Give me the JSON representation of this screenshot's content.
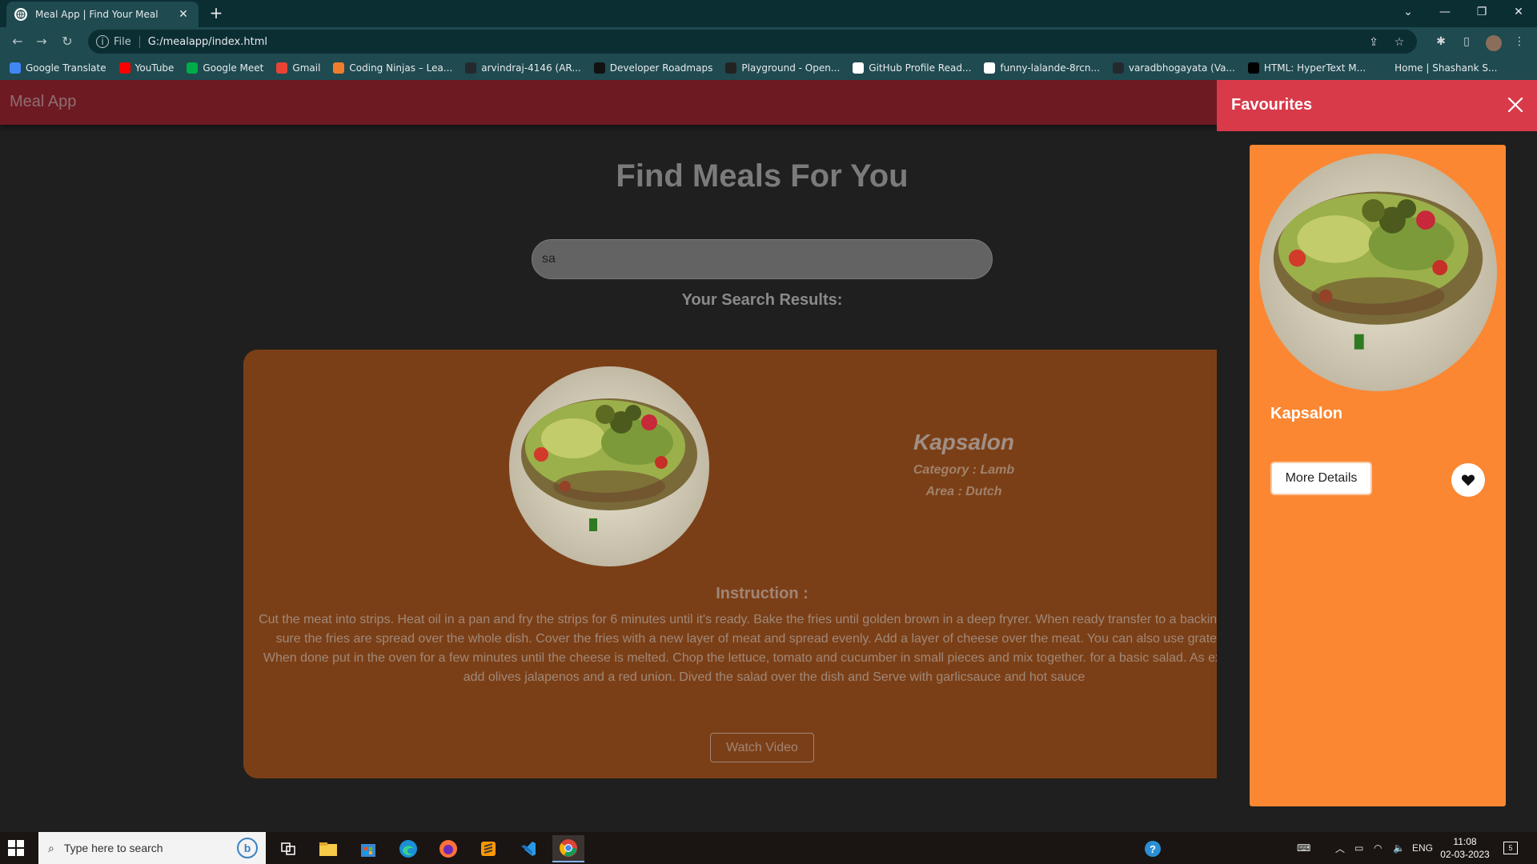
{
  "browser": {
    "tab_title": "Meal App | Find Your Meal",
    "url_scheme": "File",
    "url": "G:/mealapp/index.html",
    "bookmarks": [
      {
        "label": "Google Translate",
        "color": "#4285f4"
      },
      {
        "label": "YouTube",
        "color": "#ff0000"
      },
      {
        "label": "Google Meet",
        "color": "#00ac47"
      },
      {
        "label": "Gmail",
        "color": "#ea4335"
      },
      {
        "label": "Coding Ninjas – Lea...",
        "color": "#f07d2c"
      },
      {
        "label": "arvindraj-4146 (AR...",
        "color": "#24292e"
      },
      {
        "label": "Developer Roadmaps",
        "color": "#111111"
      },
      {
        "label": "Playground - Open...",
        "color": "#222222"
      },
      {
        "label": "GitHub Profile Read...",
        "color": "#ffffff"
      },
      {
        "label": "funny-lalande-8rcn...",
        "color": "#ffffff"
      },
      {
        "label": "varadbhogayata (Va...",
        "color": "#24292e"
      },
      {
        "label": "HTML: HyperText M...",
        "color": "#000000"
      },
      {
        "label": "Home | Shashank S...",
        "color": "#1e4a50"
      }
    ]
  },
  "app": {
    "brand": "Meal App",
    "hero_title": "Find Meals For You",
    "search_value": "sa",
    "results_label": "Your Search Results:",
    "result": {
      "name": "Kapsalon",
      "category": "Category : Lamb",
      "area": "Area : Dutch",
      "instruction_title": "Instruction :",
      "instruction_text": "Cut the meat into strips. Heat oil in a pan and fry the strips for 6 minutes until it's ready. Bake the fries until golden brown in a deep fryrer. When ready transfer to a backing dish. Make sure the fries are spread over the whole dish. Cover the fries with a new layer of meat and spread evenly. Add a layer of cheese over the meat. You can also use grated cheese. When done put in the oven for a few minutes until the cheese is melted. Chop the lettuce, tomato and cucumber in small pieces and mix together. for a basic salad. As extra you can add olives jalapenos and a red union. Dived the salad over the dish and Serve with garlicsauce and hot sauce",
      "watch_video_label": "Watch Video"
    },
    "favourites": {
      "title": "Favourites",
      "items": [
        {
          "name": "Kapsalon",
          "more_details_label": "More Details"
        }
      ]
    },
    "colors": {
      "navbar": "#6e1a23",
      "card": "#7b3f17",
      "fav_header": "#d83a4a",
      "fav_card": "#fb8732"
    }
  },
  "taskbar": {
    "search_placeholder": "Type here to search",
    "language": "ENG",
    "time": "11:08",
    "date": "02-03-2023",
    "notifications": "5"
  }
}
